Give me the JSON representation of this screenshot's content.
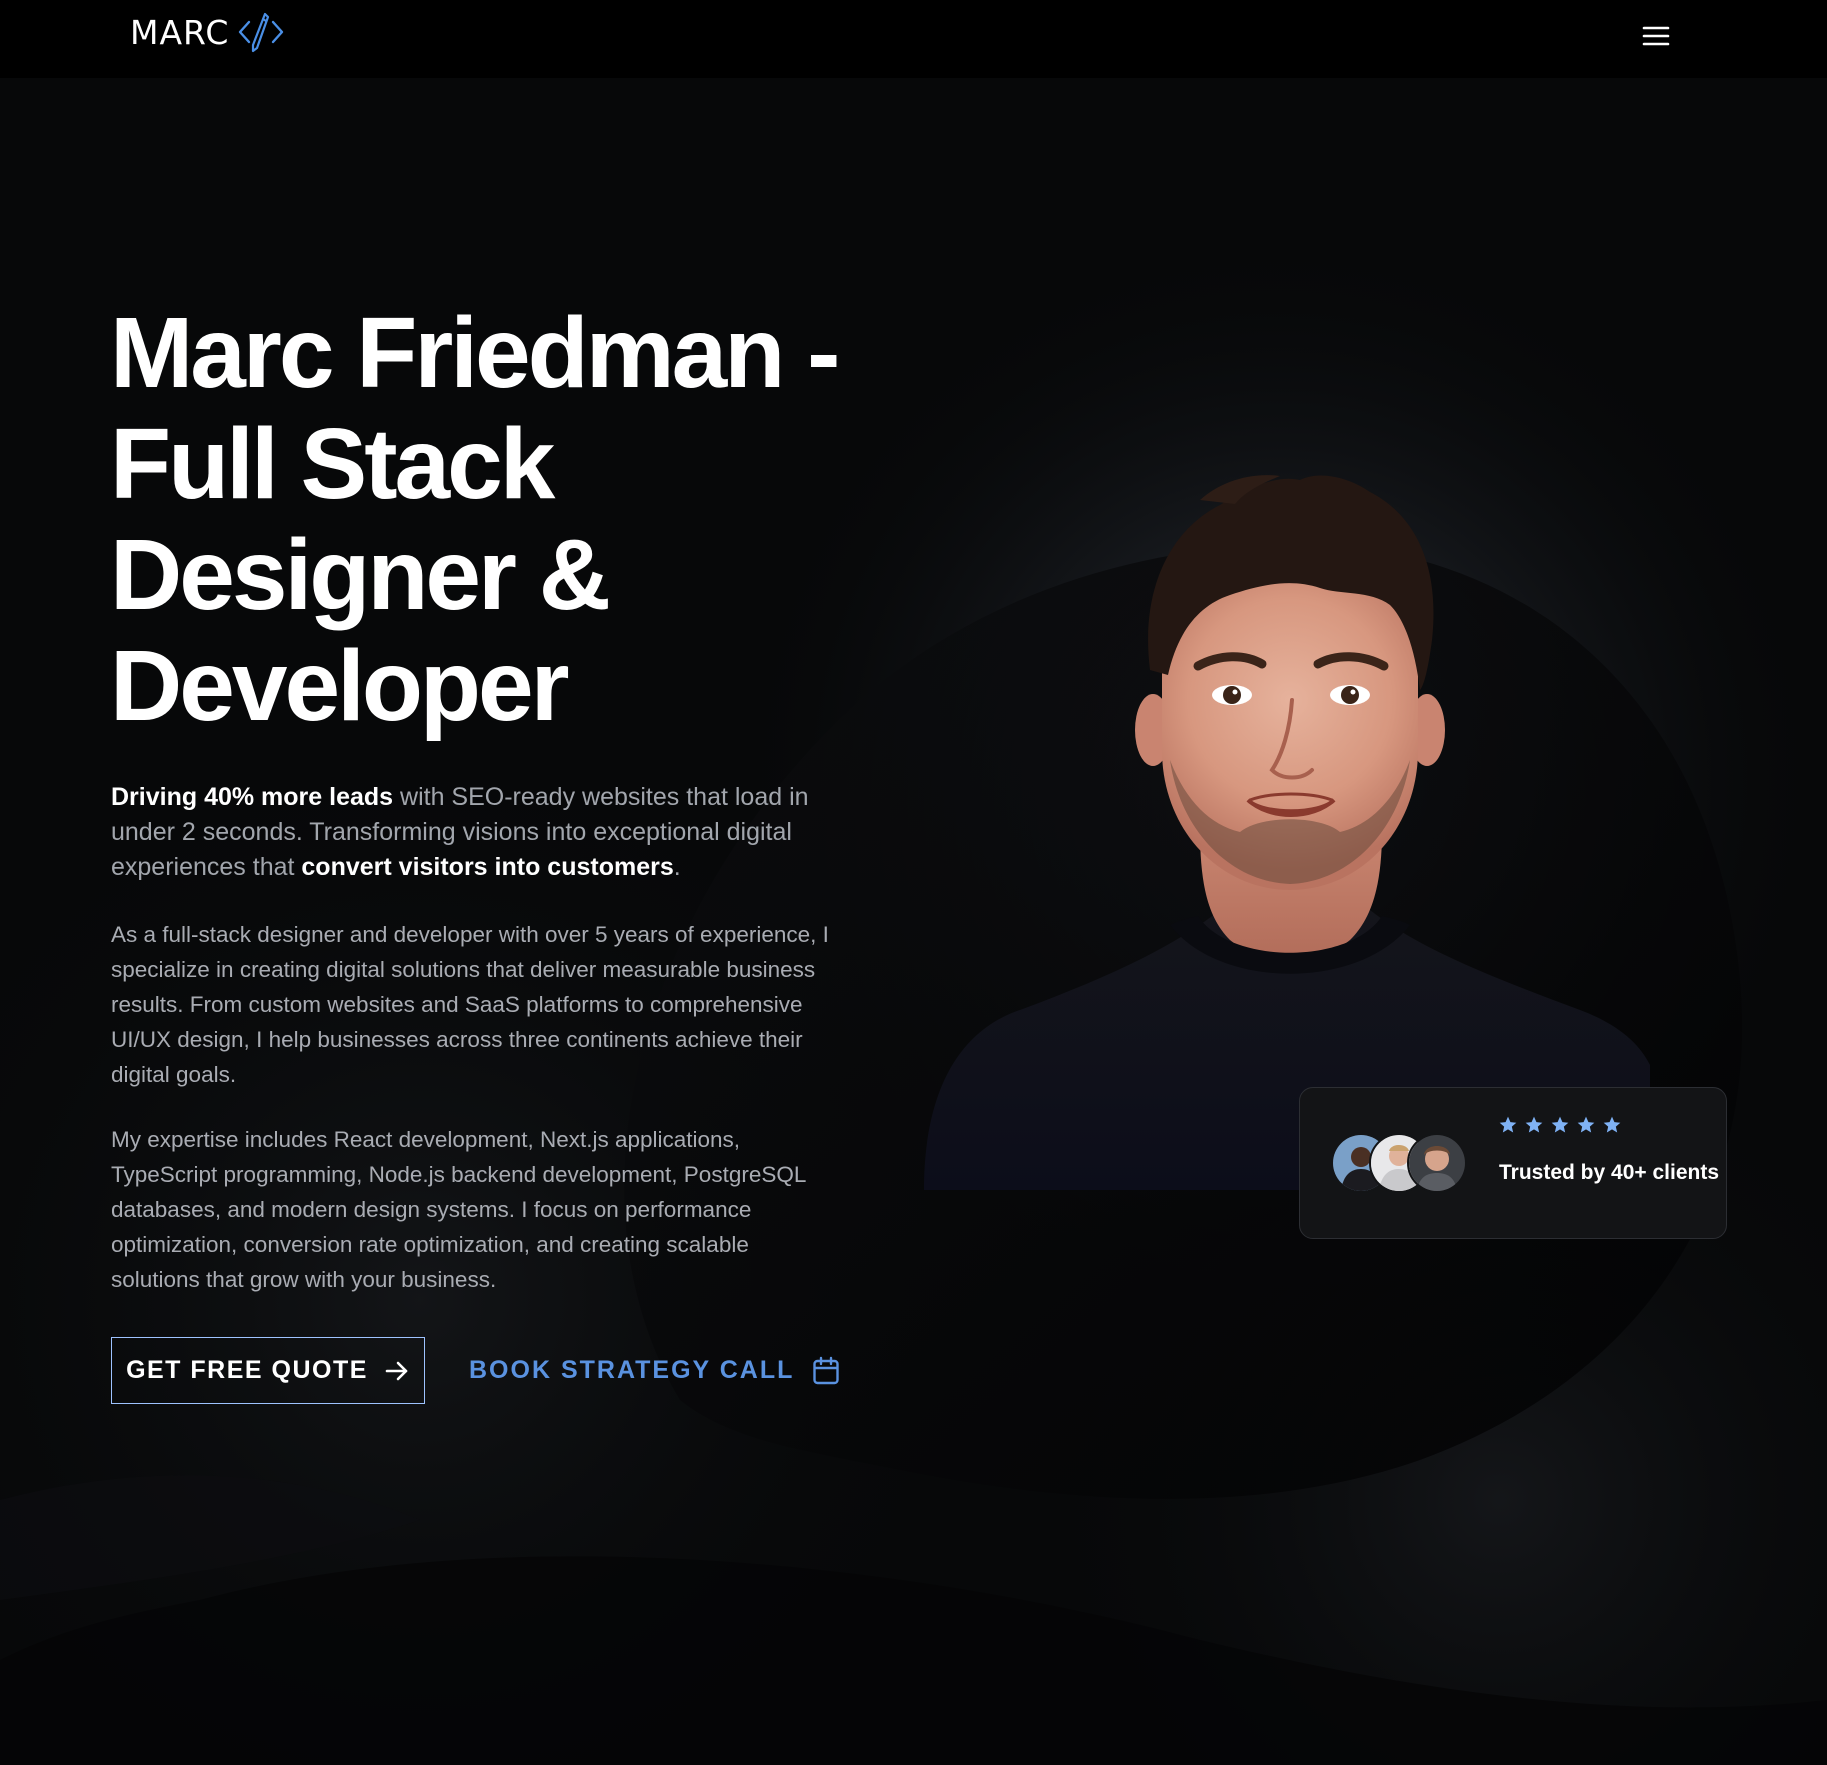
{
  "header": {
    "logo_text": "MARC",
    "logo_icon": "code-pen-icon",
    "menu_icon": "hamburger-menu-icon"
  },
  "hero": {
    "title": "Marc Friedman - Full Stack Designer & Developer",
    "tagline": {
      "lead_bold": "Driving 40% more leads",
      "middle": " with SEO-ready websites that load in under 2 seconds. Transforming visions into exceptional digital experiences that ",
      "end_bold": "convert visitors into customers",
      "end": "."
    },
    "paragraph_1": "As a full-stack designer and developer with over 5 years of experience, I specialize in creating digital solutions that deliver measurable business results. From custom websites and SaaS platforms to comprehensive UI/UX design, I help businesses across three continents achieve their digital goals.",
    "paragraph_2": "My expertise includes React development, Next.js applications, TypeScript programming, Node.js backend development, PostgreSQL databases, and modern design systems. I focus on performance optimization, conversion rate optimization, and creating scalable solutions that grow with your business."
  },
  "cta": {
    "primary_label": "GET FREE QUOTE",
    "primary_icon": "arrow-right-icon",
    "secondary_label": "BOOK STRATEGY CALL",
    "secondary_icon": "calendar-icon"
  },
  "trust": {
    "rating": 5,
    "rating_max": 5,
    "text": "Trusted by 40+ clients",
    "avatars": [
      "client-avatar-1",
      "client-avatar-2",
      "client-avatar-3"
    ]
  },
  "colors": {
    "background": "#060708",
    "header": "#000000",
    "accent": "#5a92e0",
    "button_border": "#9ec3ff",
    "star": "#7fb2f5",
    "body_text": "#a9acb3",
    "card_bg": "#131416"
  }
}
